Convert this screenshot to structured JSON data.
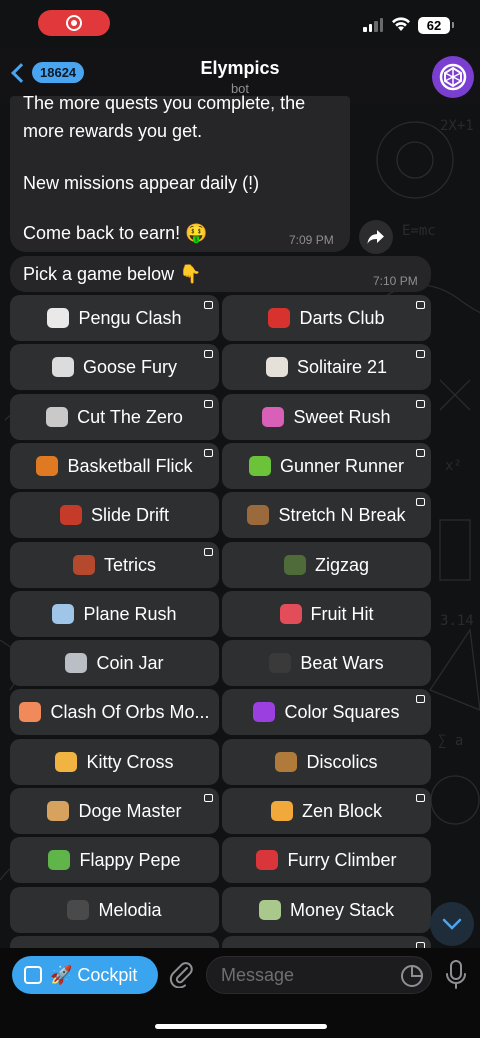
{
  "status_bar": {
    "battery": "62",
    "icons": [
      "record-icon",
      "signal-icon",
      "wifi-icon",
      "battery-icon"
    ]
  },
  "header": {
    "back_count": "18624",
    "title": "Elympics",
    "subtitle": "bot",
    "icons": [
      "chevron-left-icon",
      "bot-avatar-icon"
    ]
  },
  "messages": [
    {
      "lines": [
        "The more quests you complete, the",
        "more rewards you get.",
        "",
        "New missions appear daily (!)",
        "",
        "Come back to earn! 🤑"
      ],
      "time": "7:09 PM"
    },
    {
      "text": "Pick a game below 👇",
      "time": "7:10 PM"
    }
  ],
  "keyboard": {
    "buttons": [
      {
        "label": "Pengu Clash",
        "icon": "penguin-icon",
        "emoji_color": "#e9e9e9",
        "app": true
      },
      {
        "label": "Darts Club",
        "icon": "dart-icon",
        "emoji_color": "#d8322f",
        "app": true
      },
      {
        "label": "Goose Fury",
        "icon": "goose-icon",
        "emoji_color": "#dcdcdc",
        "app": true
      },
      {
        "label": "Solitaire 21",
        "icon": "cards-icon",
        "emoji_color": "#e6e1d8",
        "app": true
      },
      {
        "label": "Cut The Zero",
        "icon": "scissors-icon",
        "emoji_color": "#c9c9c9",
        "app": true
      },
      {
        "label": "Sweet Rush",
        "icon": "candy-icon",
        "emoji_color": "#d860b8",
        "app": true
      },
      {
        "label": "Basketball Flick",
        "icon": "basketball-icon",
        "emoji_color": "#e07a22",
        "app": true
      },
      {
        "label": "Gunner Runner",
        "icon": "water-pistol-icon",
        "emoji_color": "#6cc33a",
        "app": true
      },
      {
        "label": "Slide Drift",
        "icon": "race-car-icon",
        "emoji_color": "#c63a2a",
        "app": false
      },
      {
        "label": "Stretch N Break",
        "icon": "bow-arrow-icon",
        "emoji_color": "#9a6a3c",
        "app": true
      },
      {
        "label": "Tetrics",
        "icon": "bricks-icon",
        "emoji_color": "#b5492e",
        "app": true
      },
      {
        "label": "Zigzag",
        "icon": "helmet-icon",
        "emoji_color": "#4f6b3a",
        "app": false
      },
      {
        "label": "Plane Rush",
        "icon": "airplane-icon",
        "emoji_color": "#9fc6e8",
        "app": false
      },
      {
        "label": "Fruit Hit",
        "icon": "watermelon-icon",
        "emoji_color": "#e34d5a",
        "app": false
      },
      {
        "label": "Coin Jar",
        "icon": "jar-icon",
        "emoji_color": "#b9bfc4",
        "app": false
      },
      {
        "label": "Beat Wars",
        "icon": "music-notes-icon",
        "emoji_color": "#3a3a3a",
        "app": false
      },
      {
        "label": "Clash Of Orbs Mo...",
        "icon": "ice-cream-icon",
        "emoji_color": "#f08a5a",
        "app": false
      },
      {
        "label": "Color Squares",
        "icon": "purple-square-icon",
        "emoji_color": "#9b3fe0",
        "app": true
      },
      {
        "label": "Kitty Cross",
        "icon": "cat-icon",
        "emoji_color": "#f2b441",
        "app": false
      },
      {
        "label": "Discolics",
        "icon": "hockey-stick-icon",
        "emoji_color": "#b07a3a",
        "app": false
      },
      {
        "label": "Doge Master",
        "icon": "dog-icon",
        "emoji_color": "#d7a15e",
        "app": true
      },
      {
        "label": "Zen Block",
        "icon": "meditation-icon",
        "emoji_color": "#f2a93b",
        "app": true
      },
      {
        "label": "Flappy Pepe",
        "icon": "frog-icon",
        "emoji_color": "#5fb54a",
        "app": false
      },
      {
        "label": "Furry Climber",
        "icon": "car-icon",
        "emoji_color": "#d8363a",
        "app": false
      },
      {
        "label": "Melodia",
        "icon": "music-note-icon",
        "emoji_color": "#4a4a4a",
        "app": false
      },
      {
        "label": "Money Stack",
        "icon": "money-wings-icon",
        "emoji_color": "#a9c98c",
        "app": false
      },
      {
        "label": "",
        "icon": "",
        "emoji_color": "#2d2f30",
        "app": false
      },
      {
        "label": "",
        "icon": "",
        "emoji_color": "#2d2f30",
        "app": true
      }
    ]
  },
  "composer": {
    "cockpit_label": "🚀 Cockpit",
    "placeholder": "Message",
    "icons": [
      "paperclip-icon",
      "sticker-icon",
      "microphone-icon",
      "scroll-down-icon"
    ]
  },
  "colors": {
    "accent": "#3aa4ef",
    "bubble": "#262628",
    "button": "#2d2f30"
  }
}
